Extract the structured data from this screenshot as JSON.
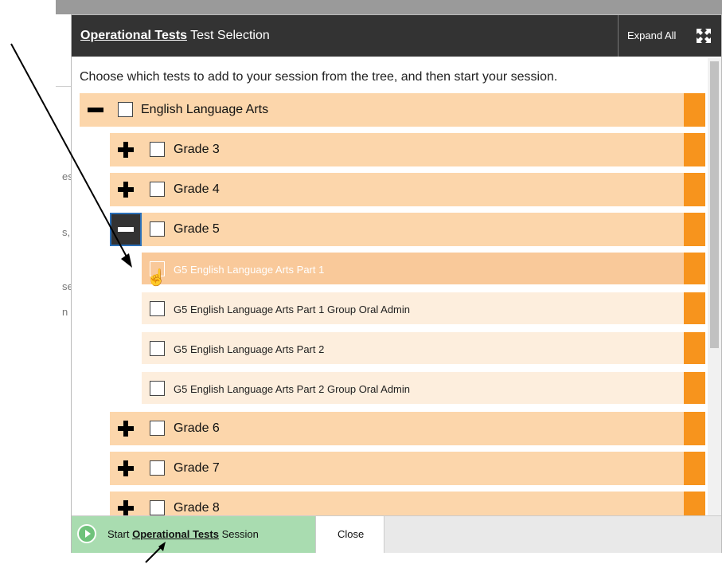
{
  "background": {
    "fragments": [
      "es",
      "s,",
      "se",
      "n"
    ]
  },
  "modal": {
    "title_link": "Operational Tests",
    "title_rest": "Test Selection",
    "expand_all_label": "Expand All",
    "instructions": "Choose which tests to add to your session from the tree, and then start your session."
  },
  "tree": {
    "root": {
      "label": "English Language Arts",
      "state": "expanded"
    },
    "grade3": {
      "label": "Grade 3",
      "state": "collapsed"
    },
    "grade4": {
      "label": "Grade 4",
      "state": "collapsed"
    },
    "grade5": {
      "label": "Grade 5",
      "state": "expanded"
    },
    "tests": [
      {
        "label": "G5 English Language Arts Part 1",
        "hover": true
      },
      {
        "label": "G5 English Language Arts Part 1 Group Oral Admin",
        "hover": false
      },
      {
        "label": "G5 English Language Arts Part 2",
        "hover": false
      },
      {
        "label": "G5 English Language Arts Part 2 Group Oral Admin",
        "hover": false
      }
    ],
    "grade6": {
      "label": "Grade 6",
      "state": "collapsed"
    },
    "grade7": {
      "label": "Grade 7",
      "state": "collapsed"
    },
    "grade8": {
      "label": "Grade 8",
      "state": "collapsed"
    }
  },
  "footer": {
    "start_prefix": "Start",
    "start_link": "Operational Tests",
    "start_suffix": "Session",
    "close_label": "Close"
  },
  "colors": {
    "header_bg": "#333333",
    "row_bg": "#fcd6ab",
    "leaf_bg": "#fdeedd",
    "accent_stripe": "#f7941d",
    "start_btn_bg": "#a9dcb0"
  }
}
